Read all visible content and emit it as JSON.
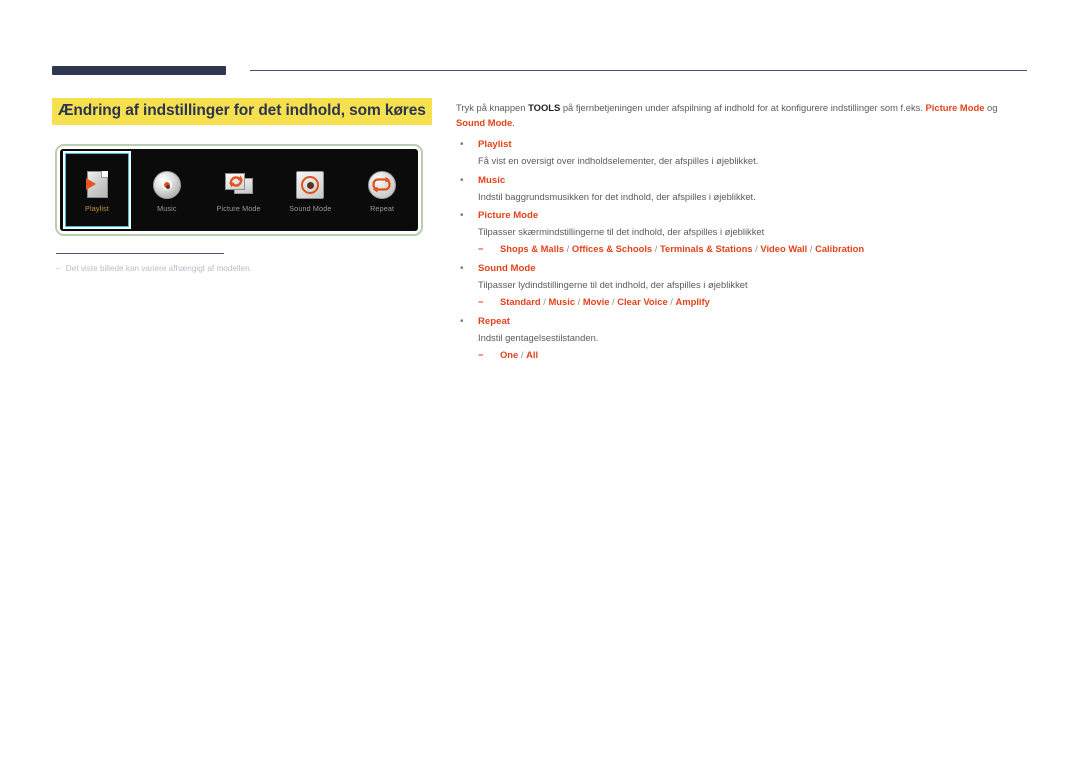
{
  "header": {
    "title": "Ændring af indstillinger for det indhold, som køres"
  },
  "figure": {
    "caption_dash": "−",
    "caption": "Det viste billede kan variere afhængigt af modellen.",
    "osd_items": [
      {
        "label": "Playlist",
        "icon": "playlist-page-play-icon",
        "selected": true
      },
      {
        "label": "Music",
        "icon": "music-disc-icon",
        "selected": false
      },
      {
        "label": "Picture Mode",
        "icon": "picture-mode-frames-refresh-icon",
        "selected": false
      },
      {
        "label": "Sound Mode",
        "icon": "sound-mode-ring-icon",
        "selected": false
      },
      {
        "label": "Repeat",
        "icon": "repeat-loop-icon",
        "selected": false
      }
    ]
  },
  "content": {
    "intro": {
      "part1": "Tryk på knappen ",
      "tools": "TOOLS",
      "part2": " på fjernbetjeningen under afspilning af indhold for at konfigurere indstillinger som f.eks. ",
      "picture_mode": "Picture Mode",
      "part3": " og ",
      "sound_mode": "Sound Mode",
      "part4": "."
    },
    "bullet_glyph": "•",
    "dash_glyph": "−",
    "items": [
      {
        "title": "Playlist",
        "desc": "Få vist en oversigt over indholdselementer, der afspilles i øjeblikket.",
        "options": []
      },
      {
        "title": "Music",
        "desc": "Indstil baggrundsmusikken for det indhold, der afspilles i øjeblikket.",
        "options": []
      },
      {
        "title": "Picture Mode",
        "desc": "Tilpasser skærmindstillingerne til det indhold, der afspilles i øjeblikket",
        "options": [
          "Shops & Malls",
          "Offices & Schools",
          "Terminals & Stations",
          "Video Wall",
          "Calibration"
        ]
      },
      {
        "title": "Sound Mode",
        "desc": "Tilpasser lydindstillingerne til det indhold, der afspilles i øjeblikket",
        "options": [
          "Standard",
          "Music",
          "Movie",
          "Clear Voice",
          "Amplify"
        ]
      },
      {
        "title": "Repeat",
        "desc": "Indstil gentagelsestilstanden.",
        "options": [
          "One",
          "All"
        ]
      }
    ]
  },
  "colors": {
    "accent_red": "#e2431c",
    "navy": "#2e374f",
    "highlight_yellow": "#f6e04e",
    "body_gray": "#5b5b5b",
    "frame_green": "#b9ceac"
  }
}
